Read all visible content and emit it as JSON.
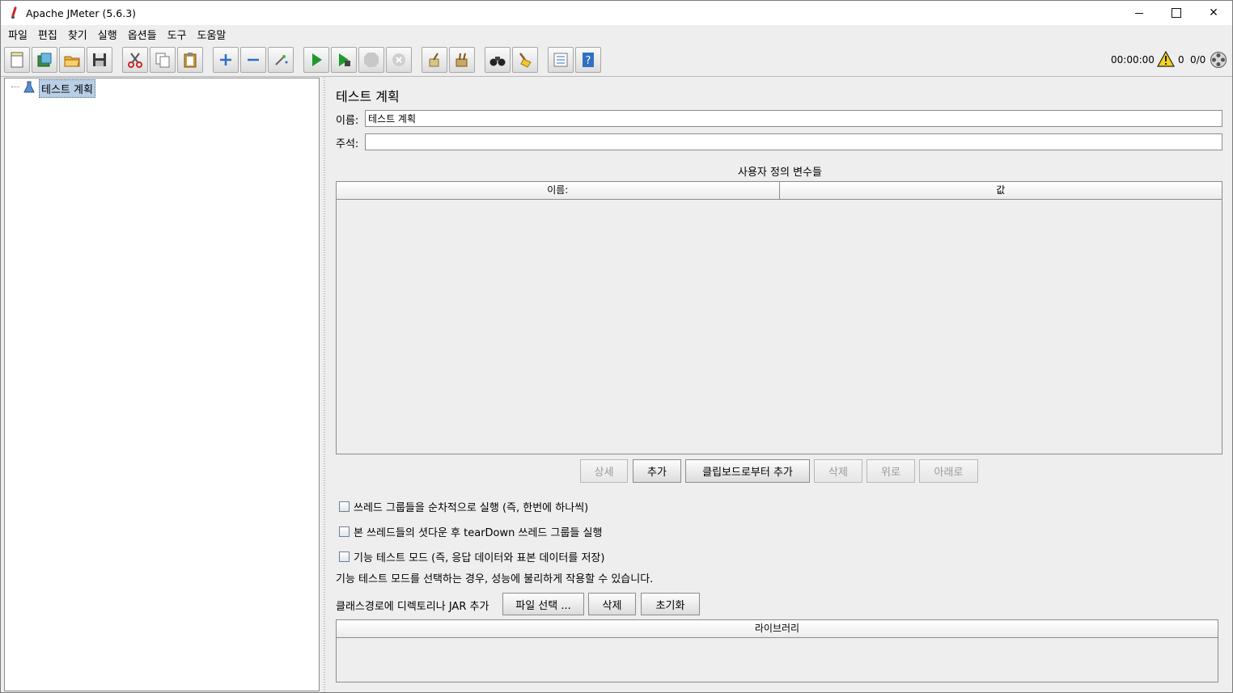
{
  "window": {
    "title": "Apache JMeter (5.6.3)",
    "min": "",
    "max": "",
    "close": "✕"
  },
  "menu": [
    "파일",
    "편집",
    "찾기",
    "실행",
    "옵션들",
    "도구",
    "도움말"
  ],
  "status": {
    "elapsed": "00:00:00",
    "warnings": "0",
    "threads": "0/0"
  },
  "tree": {
    "root_label": "테스트 계획"
  },
  "plan": {
    "title": "테스트 계획",
    "name_label": "이름:",
    "name_value": "테스트 계획",
    "comment_label": "주석:",
    "comment_value": "",
    "udv_title": "사용자 정의 변수들",
    "columns": [
      "이름:",
      "값"
    ],
    "buttons": {
      "detail": "상세",
      "add": "추가",
      "add_clipboard": "클립보드로부터 추가",
      "delete": "삭제",
      "up": "위로",
      "down": "아래로"
    },
    "options": [
      "쓰레드 그룹들을 순차적으로 실행 (즉, 한번에 하나씩)",
      "본 쓰레드들의 셧다운 후 tearDown 쓰레드 그룹들 실행",
      "기능 테스트 모드 (즉, 응답 데이터와 표본 데이터를 저장)"
    ],
    "functional_note": "기능 테스트 모드를 선택하는 경우, 성능에 불리하게 작용할 수 있습니다.",
    "classpath_label": "클래스경로에 디렉토리나 JAR 추가",
    "classpath_buttons": {
      "browse": "파일 선택 ...",
      "delete": "삭제",
      "clear": "초기화"
    },
    "library_header": "라이브러리"
  }
}
